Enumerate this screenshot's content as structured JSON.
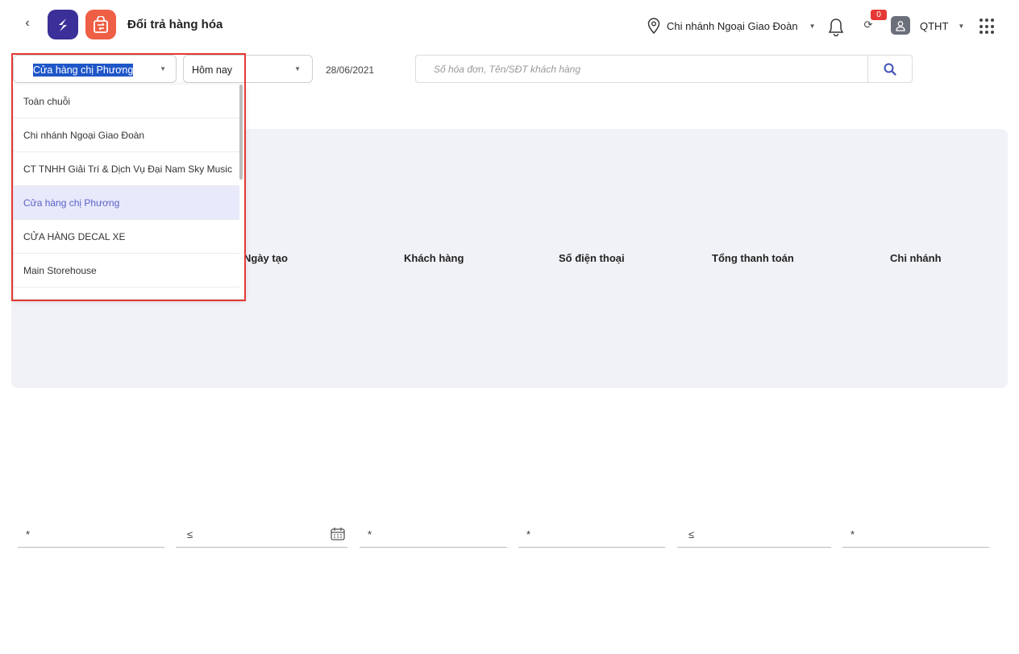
{
  "header": {
    "title": "Đổi trả hàng hóa",
    "branch": "Chi nhánh Ngoại Giao Đoàn",
    "badge_count": "0",
    "user": "QTHT"
  },
  "toolbar": {
    "store_select_value": "Cửa hàng chị Phương",
    "period_select_value": "Hôm nay",
    "date": "28/06/2021",
    "search_placeholder": "Số hóa đơn, Tên/SĐT khách hàng"
  },
  "dropdown": {
    "items": [
      "Toàn chuỗi",
      "Chi nhánh Ngoại Giao Đoàn",
      "CT TNHH Giải Trí & Dịch Vụ Đại Nam Sky Music",
      "Cửa hàng chị Phương",
      "CỬA HÀNG DECAL XE",
      "Main Storehouse"
    ],
    "selected": "Cửa hàng chị Phương"
  },
  "table": {
    "columns": [
      "Ngày tạo",
      "Khách hàng",
      "Số điện thoại",
      "Tổng thanh toán",
      "Chi nhánh"
    ]
  },
  "filters": [
    "*",
    "≤",
    "*",
    "*",
    "≤",
    "*"
  ],
  "colors": {
    "brand_logo": "#3b2f99",
    "app_icon": "#ef5f45",
    "highlight_border": "#e53935",
    "selected_item_bg": "#e8e9fb",
    "selected_item_text": "#5a62c8",
    "panel_bg": "#f1f2f7"
  }
}
